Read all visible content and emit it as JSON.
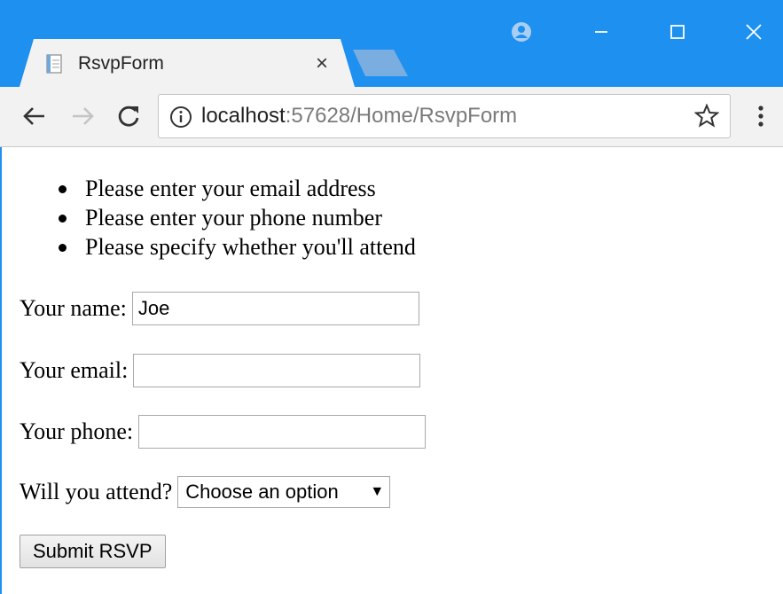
{
  "browser": {
    "tab_title": "RsvpForm",
    "tab_close": "×",
    "url_host": "localhost",
    "url_rest": ":57628/Home/RsvpForm",
    "accent_color": "#1e90f0",
    "icons": [
      "page-favicon-icon",
      "account-icon",
      "minimize-icon",
      "maximize-icon",
      "close-icon",
      "back-arrow-icon",
      "forward-arrow-icon",
      "reload-icon",
      "info-icon",
      "star-icon",
      "menu-icon"
    ]
  },
  "validation": {
    "errors": [
      "Please enter your email address",
      "Please enter your phone number",
      "Please specify whether you'll attend"
    ]
  },
  "form": {
    "name_label": "Your name:",
    "name_value": "Joe",
    "email_label": "Your email:",
    "email_value": "",
    "phone_label": "Your phone:",
    "phone_value": "",
    "attend_label": "Will you attend?",
    "attend_selected": "Choose an option",
    "attend_arrow": "▼",
    "submit_label": "Submit RSVP"
  }
}
